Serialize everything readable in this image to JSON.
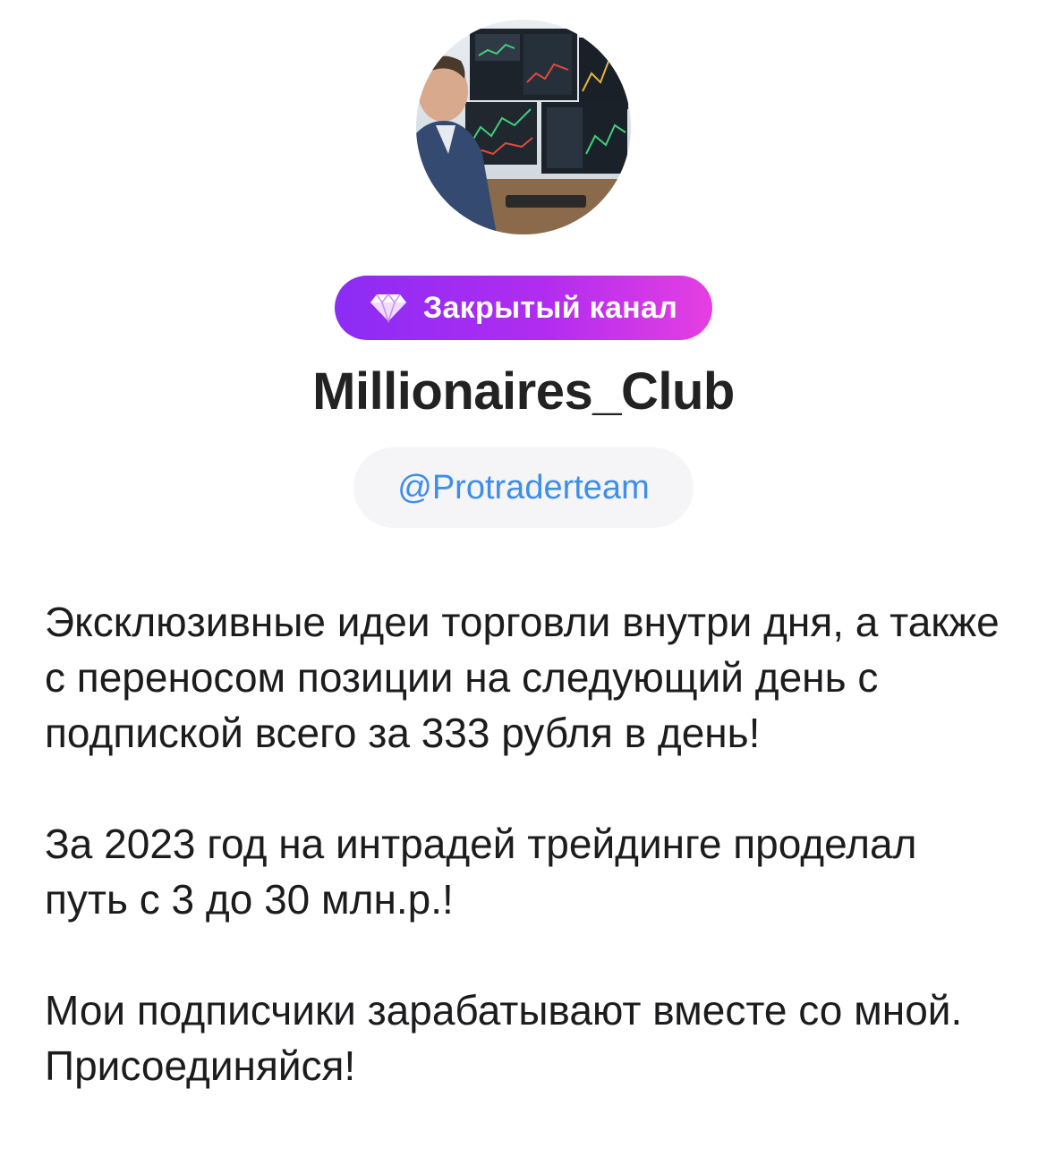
{
  "channel": {
    "badge_label": "Закрытый канал",
    "badge_icon": "diamond-icon",
    "title": "Millionaires_Club",
    "handle": "@Protraderteam",
    "description": [
      "Эксклюзивные идеи торговли внутри дня, а также с переносом позиции на следующий день с подпиской всего за 333 рубля в день!",
      "За 2023 год на интрадей трейдинге проделал путь с 3 до 30 млн.р.!",
      "Мои подписчики зарабатывают вместе со мной. Присоединяйся!"
    ]
  },
  "colors": {
    "badge_gradient_start": "#8b2cf5",
    "badge_gradient_end": "#e53fe1",
    "handle_text": "#3e8eea",
    "handle_background": "#f5f5f7",
    "title_text": "#222222",
    "body_text": "#1c1c1e"
  }
}
